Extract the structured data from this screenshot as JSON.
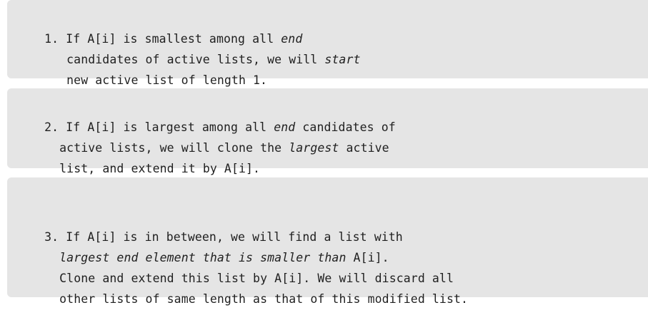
{
  "items": [
    {
      "lines": [
        [
          {
            "t": "1. If A[i] is smallest among all "
          },
          {
            "t": "end",
            "em": true
          }
        ],
        [
          {
            "t": "candidates of active lists, we will "
          },
          {
            "t": "start",
            "em": true
          }
        ],
        [
          {
            "t": "new active list of length 1."
          }
        ]
      ]
    },
    {
      "lines": [
        [
          {
            "t": "2. If A[i] is largest among all "
          },
          {
            "t": "end",
            "em": true
          },
          {
            "t": " candidates of"
          }
        ],
        [
          {
            "t": "active lists, we will clone the "
          },
          {
            "t": "largest",
            "em": true
          },
          {
            "t": " active"
          }
        ],
        [
          {
            "t": "list, and extend it by A[i]."
          }
        ]
      ]
    },
    {
      "lines": [
        [
          {
            "t": "3. If A[i] is in between, we will find a list with"
          }
        ],
        [
          {
            "t": "largest end element that is smaller than",
            "em": true
          },
          {
            "t": " A[i]."
          }
        ],
        [
          {
            "t": "Clone and extend this list by A[i]. We will discard all"
          }
        ],
        [
          {
            "t": "other lists of same length as that of this modified list."
          }
        ]
      ]
    }
  ]
}
